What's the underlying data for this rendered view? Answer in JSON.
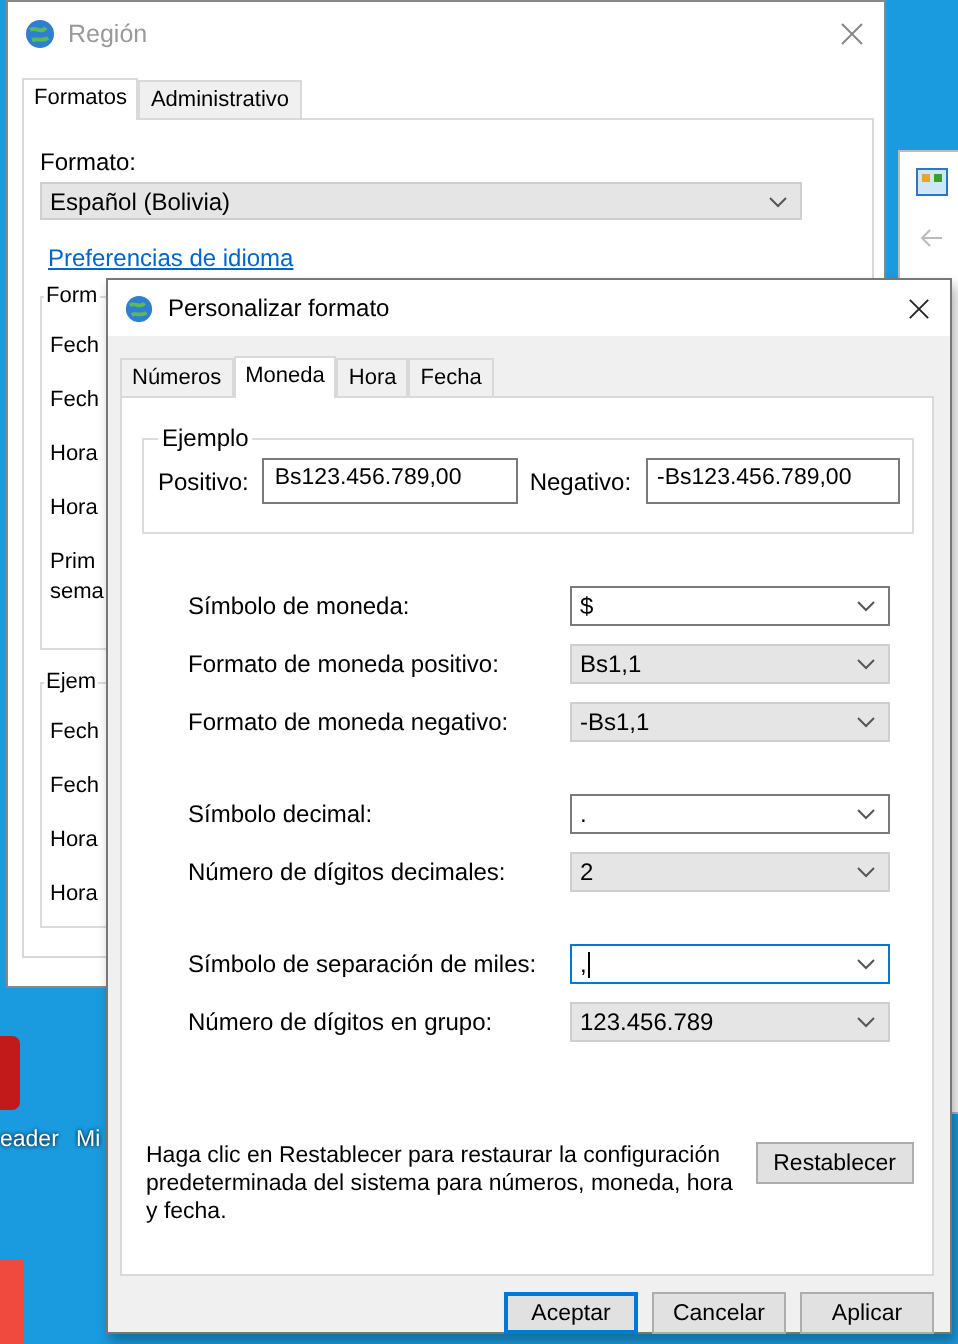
{
  "desktop": {
    "icon_labels": [
      "eader",
      "Mi"
    ]
  },
  "region_window": {
    "title": "Región",
    "tabs": [
      {
        "label": "Formatos",
        "selected": true
      },
      {
        "label": "Administrativo",
        "selected": false
      }
    ],
    "format_label": "Formato:",
    "format_value": "Español (Bolivia)",
    "link": "Preferencias de idioma",
    "groups": [
      {
        "title": "Form",
        "rows": [
          {
            "lines": [
              "Fech"
            ]
          },
          {
            "lines": [
              "Fech"
            ]
          },
          {
            "lines": [
              "Hora"
            ]
          },
          {
            "lines": [
              "Hora"
            ]
          },
          {
            "lines": [
              "Prim",
              "sema"
            ]
          }
        ]
      },
      {
        "title": "Ejem",
        "rows": [
          {
            "lines": [
              "Fech"
            ]
          },
          {
            "lines": [
              "Fech"
            ]
          },
          {
            "lines": [
              "Hora"
            ]
          },
          {
            "lines": [
              "Hora"
            ]
          }
        ]
      }
    ]
  },
  "dialog": {
    "title": "Personalizar formato",
    "tabs": [
      {
        "label": "Números",
        "selected": false
      },
      {
        "label": "Moneda",
        "selected": true
      },
      {
        "label": "Hora",
        "selected": false
      },
      {
        "label": "Fecha",
        "selected": false
      }
    ],
    "example": {
      "title": "Ejemplo",
      "positive_label": "Positivo:",
      "positive_value": "Bs123.456.789,00",
      "negative_label": "Negativo:",
      "negative_value": "-Bs123.456.789,00"
    },
    "setting_groups": [
      {
        "rows": [
          {
            "label": "Símbolo de moneda:",
            "value": "$",
            "editable": true,
            "focused": false
          },
          {
            "label": "Formato de moneda positivo:",
            "value": "Bs1,1",
            "editable": false,
            "focused": false
          },
          {
            "label": "Formato de moneda negativo:",
            "value": "-Bs1,1",
            "editable": false,
            "focused": false
          }
        ]
      },
      {
        "rows": [
          {
            "label": "Símbolo decimal:",
            "value": ".",
            "editable": true,
            "focused": false
          },
          {
            "label": "Número de dígitos decimales:",
            "value": "2",
            "editable": false,
            "focused": false
          }
        ]
      },
      {
        "rows": [
          {
            "label": "Símbolo de separación de miles:",
            "value": ",",
            "editable": true,
            "focused": true
          },
          {
            "label": "Número de dígitos en grupo:",
            "value": "123.456.789",
            "editable": false,
            "focused": false
          }
        ]
      }
    ],
    "note": "Haga clic en Restablecer para restaurar la configuración predeterminada del sistema para números, moneda, hora y fecha.",
    "reset_button": "Restablecer",
    "buttons": [
      {
        "label": "Aceptar",
        "default": true
      },
      {
        "label": "Cancelar",
        "default": false
      },
      {
        "label": "Aplicar",
        "default": false
      }
    ]
  }
}
